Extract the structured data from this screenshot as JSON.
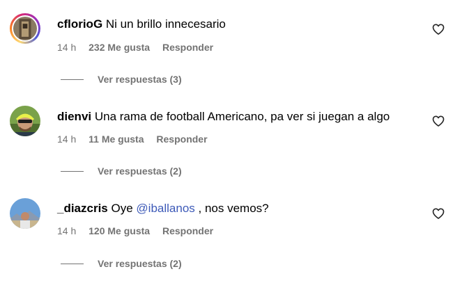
{
  "comments": [
    {
      "username": "cflorioG",
      "text": "Ni un brillo innecesario",
      "time": "14 h",
      "likes": "232 Me gusta",
      "reply_label": "Responder",
      "view_replies": "Ver respuestas (3)",
      "avatar_icon": "user-avatar-story-ring"
    },
    {
      "username": "dienvi",
      "text": "Una rama de football Americano, pa ver si juegan a algo",
      "time": "14 h",
      "likes": "11 Me gusta",
      "reply_label": "Responder",
      "view_replies": "Ver respuestas (2)",
      "avatar_icon": "user-avatar-cyclist"
    },
    {
      "username": "_diazcris",
      "text_before": "Oye ",
      "mention": "@iballanos",
      "text_after": " , nos vemos?",
      "time": "14 h",
      "likes": "120 Me gusta",
      "reply_label": "Responder",
      "view_replies": "Ver respuestas (2)",
      "avatar_icon": "user-avatar-landscape"
    }
  ],
  "icons": {
    "like": "heart-outline-icon"
  },
  "colors": {
    "muted": "#737373",
    "mention": "#3d5ab8",
    "text": "#000000"
  }
}
